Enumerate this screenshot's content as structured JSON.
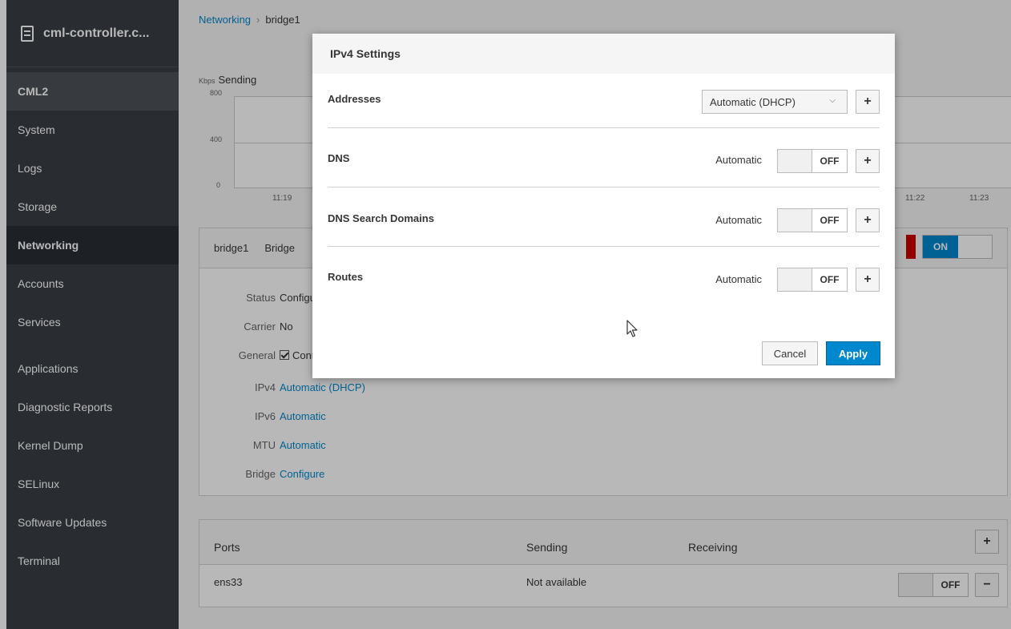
{
  "sidebar": {
    "host": "cml-controller.c...",
    "section": "CML2",
    "items": [
      {
        "label": "System"
      },
      {
        "label": "Logs"
      },
      {
        "label": "Storage"
      },
      {
        "label": "Networking"
      },
      {
        "label": "Accounts"
      },
      {
        "label": "Services"
      },
      {
        "label": "Applications"
      },
      {
        "label": "Diagnostic Reports"
      },
      {
        "label": "Kernel Dump"
      },
      {
        "label": "SELinux"
      },
      {
        "label": "Software Updates"
      },
      {
        "label": "Terminal"
      }
    ]
  },
  "breadcrumb": {
    "parent": "Networking",
    "sep": "›",
    "current": "bridge1"
  },
  "graph": {
    "unit": "Kbps",
    "title": "Sending",
    "yticks": [
      "800",
      "400",
      "0"
    ],
    "xticks": [
      "11:19",
      "11:22",
      "11:23"
    ]
  },
  "iface": {
    "name": "bridge1",
    "type": "Bridge",
    "toggle": "ON",
    "details": [
      {
        "key": "Status",
        "value": "Configuring"
      },
      {
        "key": "Carrier",
        "value": "No"
      },
      {
        "key": "General",
        "value": "Connect automatically"
      },
      {
        "key": "IPv4",
        "value": "Automatic (DHCP)"
      },
      {
        "key": "IPv6",
        "value": "Automatic"
      },
      {
        "key": "MTU",
        "value": "Automatic"
      },
      {
        "key": "Bridge",
        "value": "Configure"
      }
    ]
  },
  "ports": {
    "headers": {
      "ports": "Ports",
      "sending": "Sending",
      "receiving": "Receiving"
    },
    "rows": [
      {
        "name": "ens33",
        "sending": "Not available",
        "toggle": "OFF"
      }
    ],
    "add": "+",
    "remove": "−"
  },
  "modal": {
    "title": "IPv4 Settings",
    "rows": [
      {
        "label": "Addresses",
        "select": "Automatic (DHCP)"
      },
      {
        "label": "DNS",
        "auto": "Automatic",
        "toggle": "OFF"
      },
      {
        "label": "DNS Search Domains",
        "auto": "Automatic",
        "toggle": "OFF"
      },
      {
        "label": "Routes",
        "auto": "Automatic",
        "toggle": "OFF"
      }
    ],
    "plus": "+",
    "cancel": "Cancel",
    "apply": "Apply"
  },
  "colors": {
    "accent": "#0088ce",
    "sidebar": "#393f44",
    "danger": "#cc0000"
  }
}
